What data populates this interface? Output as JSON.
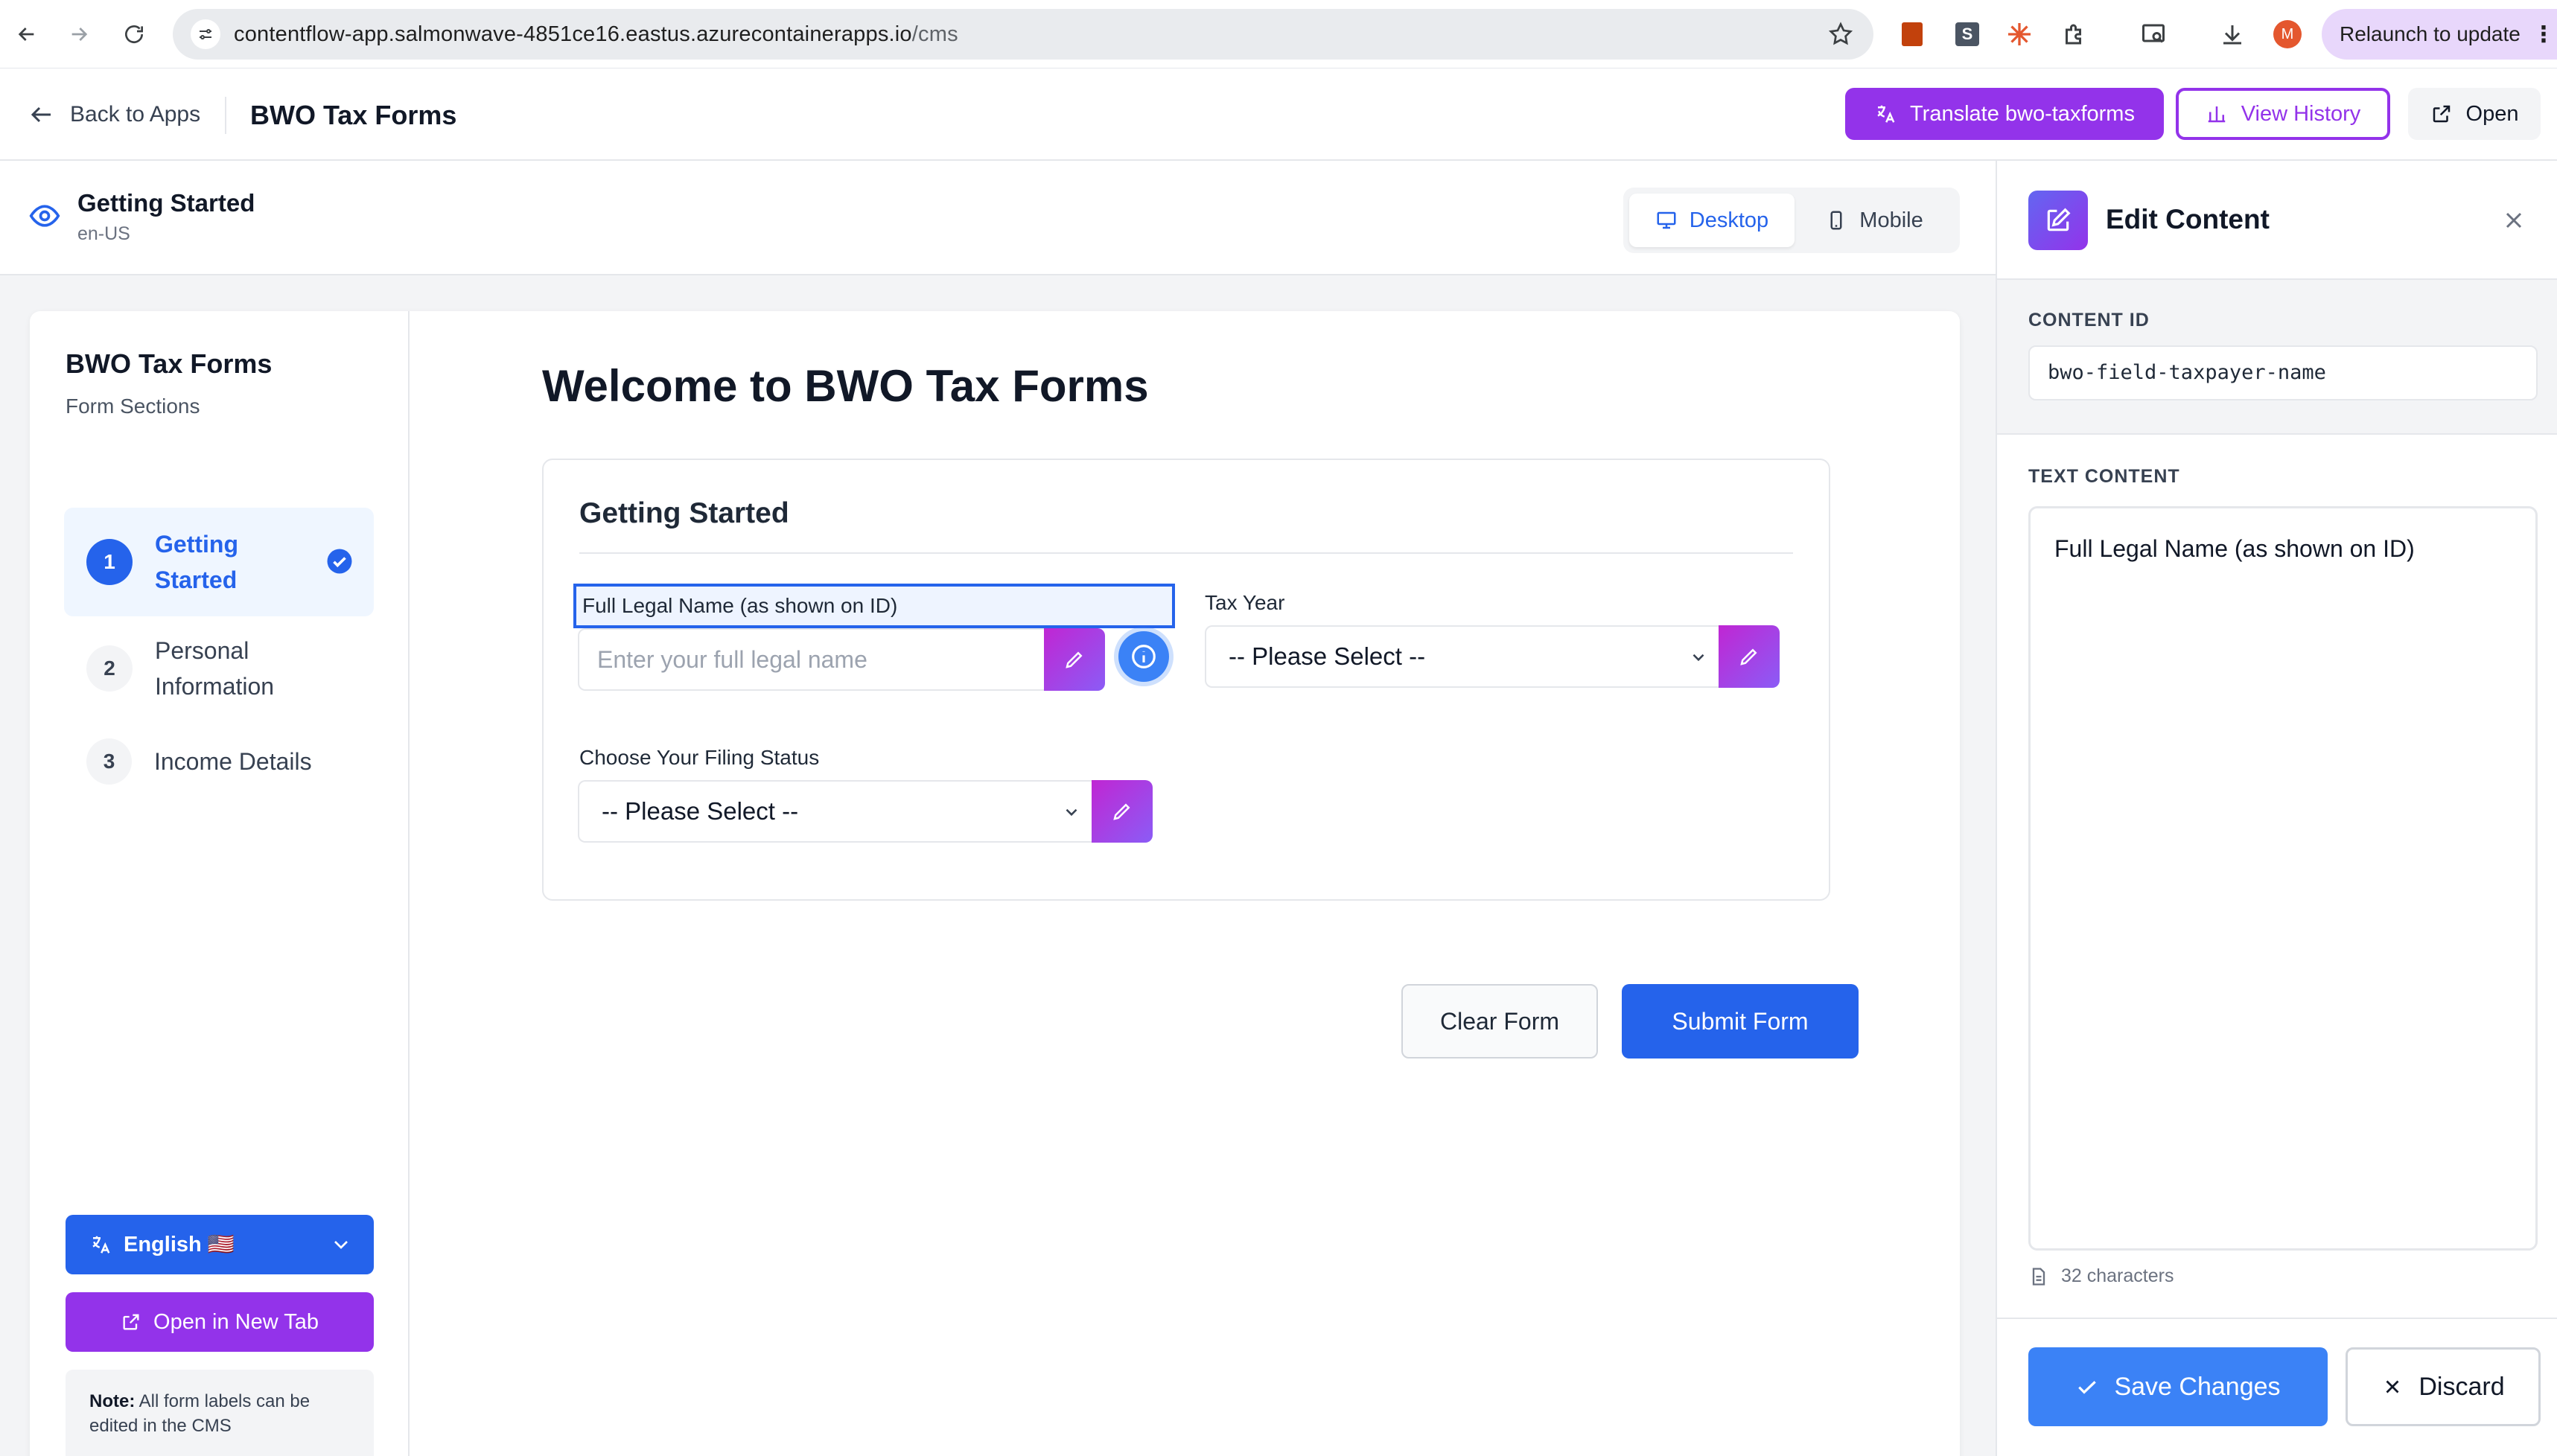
{
  "browser": {
    "url_host": "contentflow-app.salmonwave-4851ce16.eastus.azurecontainerapps.io",
    "url_path": "/cms",
    "relaunch_label": "Relaunch to update",
    "profile_initial": "M"
  },
  "header": {
    "back_label": "Back to Apps",
    "app_title": "BWO Tax Forms",
    "translate_label": "Translate bwo-taxforms",
    "history_label": "View History",
    "open_label": "Open"
  },
  "preview": {
    "page_title": "Getting Started",
    "locale": "en-US",
    "device_desktop": "Desktop",
    "device_mobile": "Mobile",
    "active_device": "Desktop"
  },
  "form_sidebar": {
    "title": "BWO Tax Forms",
    "subtitle": "Form Sections",
    "steps": [
      {
        "number": "1",
        "label": "Getting Started",
        "active": true,
        "completed": true
      },
      {
        "number": "2",
        "label": "Personal Information",
        "active": false
      },
      {
        "number": "3",
        "label": "Income Details",
        "active": false
      }
    ],
    "language_label": "English 🇺🇸",
    "open_new_tab_label": "Open in New Tab",
    "note_bold": "Note:",
    "note_text": " All form labels can be edited in the CMS"
  },
  "form": {
    "main_title": "Welcome to BWO Tax Forms",
    "section_title": "Getting Started",
    "full_name_label": "Full Legal Name (as shown on ID)",
    "full_name_placeholder": "Enter your full legal name",
    "tax_year_label": "Tax Year",
    "tax_year_value": "-- Please Select --",
    "filing_status_label": "Choose Your Filing Status",
    "filing_status_value": "-- Please Select --",
    "clear_label": "Clear Form",
    "submit_label": "Submit Form"
  },
  "edit_panel": {
    "title": "Edit Content",
    "content_id_label": "CONTENT ID",
    "content_id_value": "bwo-field-taxpayer-name",
    "text_content_label": "TEXT CONTENT",
    "text_content_value": "Full Legal Name (as shown on ID)",
    "char_count": "32 characters",
    "save_label": "Save Changes",
    "discard_label": "Discard"
  },
  "colors": {
    "primary_blue": "#2563eb",
    "purple": "#9333ea",
    "pencil_gradient_start": "#c026d3",
    "pencil_gradient_end": "#8b5cf6"
  }
}
